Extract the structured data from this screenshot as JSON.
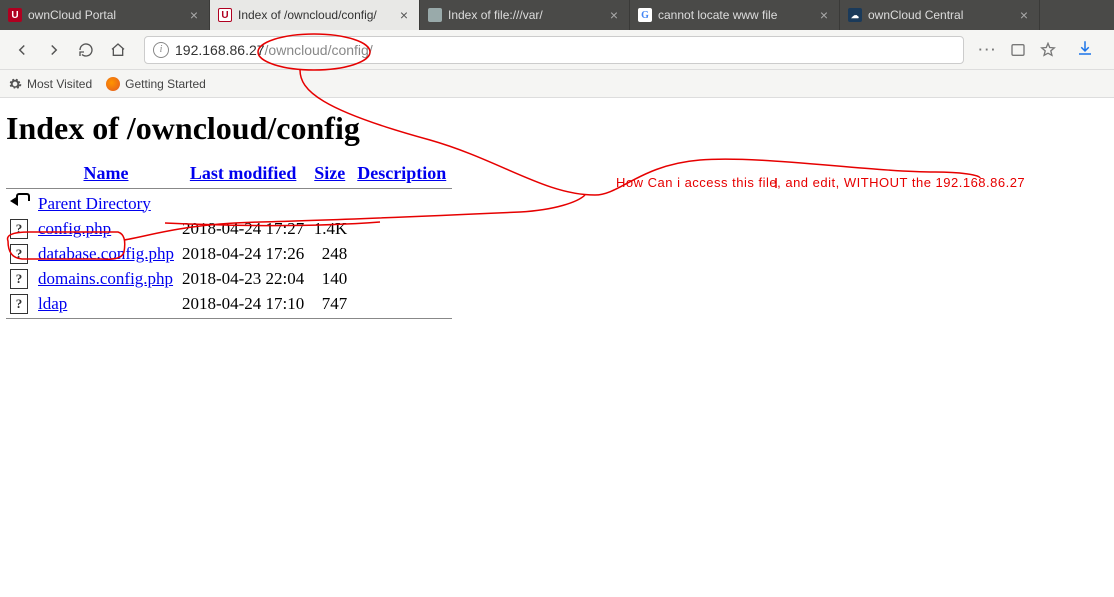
{
  "tabs": [
    {
      "title": "ownCloud Portal",
      "favicon_bg": "#b00020",
      "favicon_text": "U",
      "favicon_color": "#fff",
      "active": false
    },
    {
      "title": "Index of /owncloud/config/",
      "favicon_bg": "#fff",
      "favicon_text": "U",
      "favicon_color": "#b00020",
      "active": true
    },
    {
      "title": "Index of file:///var/",
      "favicon_bg": "#ccc",
      "favicon_text": "",
      "favicon_color": "#555",
      "active": false
    },
    {
      "title": "cannot locate www file",
      "favicon_bg": "#fff",
      "favicon_text": "G",
      "favicon_color": "#4285f4",
      "active": false
    },
    {
      "title": "ownCloud Central",
      "favicon_bg": "#1a3a5a",
      "favicon_text": "",
      "favicon_color": "#fff",
      "active": false
    }
  ],
  "url": {
    "host": "192.168.86.27",
    "path": "/owncloud/config/"
  },
  "bookmarks": {
    "most_visited": "Most Visited",
    "getting_started": "Getting Started"
  },
  "page_title": "Index of /owncloud/config",
  "columns": {
    "name": "Name",
    "modified": "Last modified",
    "size": "Size",
    "description": "Description"
  },
  "parent_dir": "Parent Directory",
  "rows": [
    {
      "name": "config.php",
      "modified": "2018-04-24 17:27",
      "size": "1.4K"
    },
    {
      "name": "database.config.php",
      "modified": "2018-04-24 17:26",
      "size": "248"
    },
    {
      "name": "domains.config.php",
      "modified": "2018-04-23 22:04",
      "size": "140"
    },
    {
      "name": "ldap",
      "modified": "2018-04-24 17:10",
      "size": "747"
    }
  ],
  "annotation": "How Can i access this file, and edit, WITHOUT the 192.168.86.27"
}
